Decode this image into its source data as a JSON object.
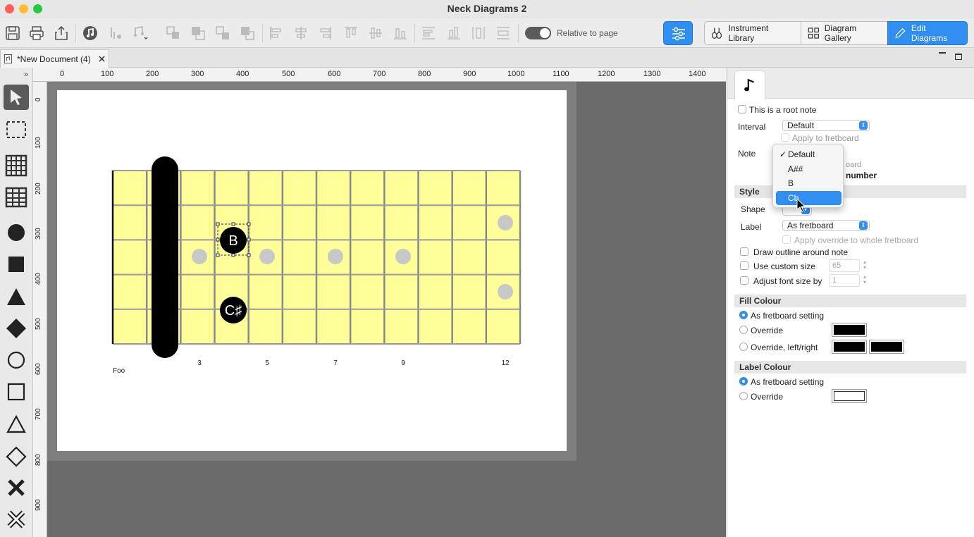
{
  "window": {
    "title": "Neck Diagrams 2"
  },
  "toolbar": {
    "toggle_label": "Relative to page",
    "segments": {
      "instrument_library": "Instrument Library",
      "diagram_gallery": "Diagram Gallery",
      "edit_diagrams": "Edit Diagrams"
    }
  },
  "document_tab": {
    "label": "*New Document (4)"
  },
  "ruler": {
    "top": [
      "0",
      "100",
      "200",
      "300",
      "400",
      "500",
      "600",
      "700",
      "800",
      "900",
      "1000",
      "1100",
      "1200",
      "1300",
      "1400"
    ],
    "left": [
      "0",
      "100",
      "200",
      "300",
      "400",
      "500",
      "600",
      "700",
      "800",
      "900"
    ]
  },
  "fretboard": {
    "fret_numbers": [
      "3",
      "5",
      "7",
      "9",
      "12"
    ],
    "caption": "Foo",
    "notes": [
      {
        "label": "B",
        "string": 3,
        "fret": 4,
        "selected": true
      },
      {
        "label": "C♯",
        "string": 5,
        "fret": 4,
        "selected": false
      }
    ]
  },
  "inspector": {
    "tab_icon": "music-note-icon",
    "root_note_label": "This is a root note",
    "interval_label": "Interval",
    "interval_value": "Default",
    "apply_to_fretboard": "Apply to fretboard",
    "note_label": "Note",
    "note_hidden_fragment_1": "oard",
    "note_hidden_fragment_2": "number",
    "style_header": "Style",
    "shape_label": "Shape",
    "label_label": "Label",
    "label_value": "As fretboard",
    "apply_override": "Apply override to whole fretboard",
    "draw_outline": "Draw outline around note",
    "custom_size": "Use custom size",
    "custom_size_value": "65",
    "adjust_font": "Adjust font size by",
    "adjust_font_value": "1",
    "fill_header": "Fill Colour",
    "fill_opt1": "As fretboard setting",
    "fill_opt2": "Override",
    "fill_opt3": "Override, left/right",
    "label_colour_header": "Label Colour",
    "lc_opt1": "As fretboard setting",
    "lc_opt2": "Override"
  },
  "note_menu": {
    "items": [
      "Default",
      "A##",
      "B",
      "Cb"
    ],
    "checked": "✓"
  },
  "colors": {
    "fretboard": "#ffff99",
    "accent": "#2f8ef0"
  }
}
